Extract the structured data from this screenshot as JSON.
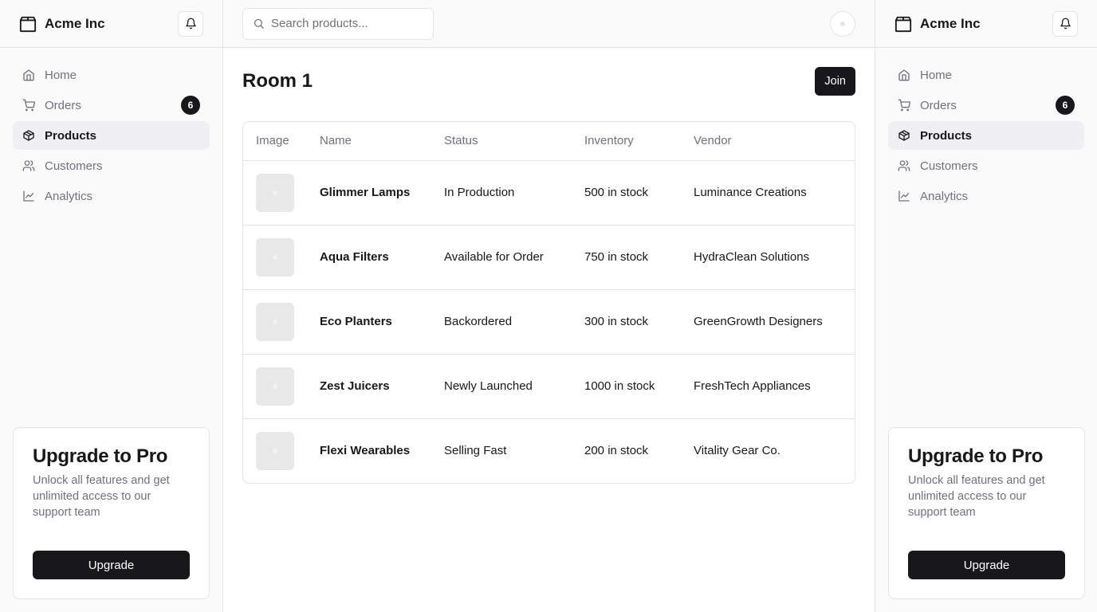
{
  "brand": {
    "name": "Acme Inc"
  },
  "nav": [
    {
      "label": "Home",
      "icon": "home-icon",
      "active": false
    },
    {
      "label": "Orders",
      "icon": "cart-icon",
      "active": false,
      "badge": "6"
    },
    {
      "label": "Products",
      "icon": "package-icon",
      "active": true
    },
    {
      "label": "Customers",
      "icon": "users-icon",
      "active": false
    },
    {
      "label": "Analytics",
      "icon": "line-chart-icon",
      "active": false
    }
  ],
  "promo": {
    "title": "Upgrade to Pro",
    "text": "Unlock all features and get unlimited access to our support team",
    "button": "Upgrade"
  },
  "search": {
    "placeholder": "Search products..."
  },
  "page": {
    "title": "Room 1",
    "join_label": "Join"
  },
  "table": {
    "headers": [
      "Image",
      "Name",
      "Status",
      "Inventory",
      "Vendor"
    ],
    "rows": [
      {
        "name": "Glimmer Lamps",
        "status": "In Production",
        "inventory": "500 in stock",
        "vendor": "Luminance Creations"
      },
      {
        "name": "Aqua Filters",
        "status": "Available for Order",
        "inventory": "750 in stock",
        "vendor": "HydraClean Solutions"
      },
      {
        "name": "Eco Planters",
        "status": "Backordered",
        "inventory": "300 in stock",
        "vendor": "GreenGrowth Designers"
      },
      {
        "name": "Zest Juicers",
        "status": "Newly Launched",
        "inventory": "1000 in stock",
        "vendor": "FreshTech Appliances"
      },
      {
        "name": "Flexi Wearables",
        "status": "Selling Fast",
        "inventory": "200 in stock",
        "vendor": "Vitality Gear Co."
      }
    ]
  },
  "colors": {
    "accent": "#18181b",
    "muted": "#71717a",
    "border": "#e4e4e7",
    "sidebar_bg": "#fafafa"
  }
}
